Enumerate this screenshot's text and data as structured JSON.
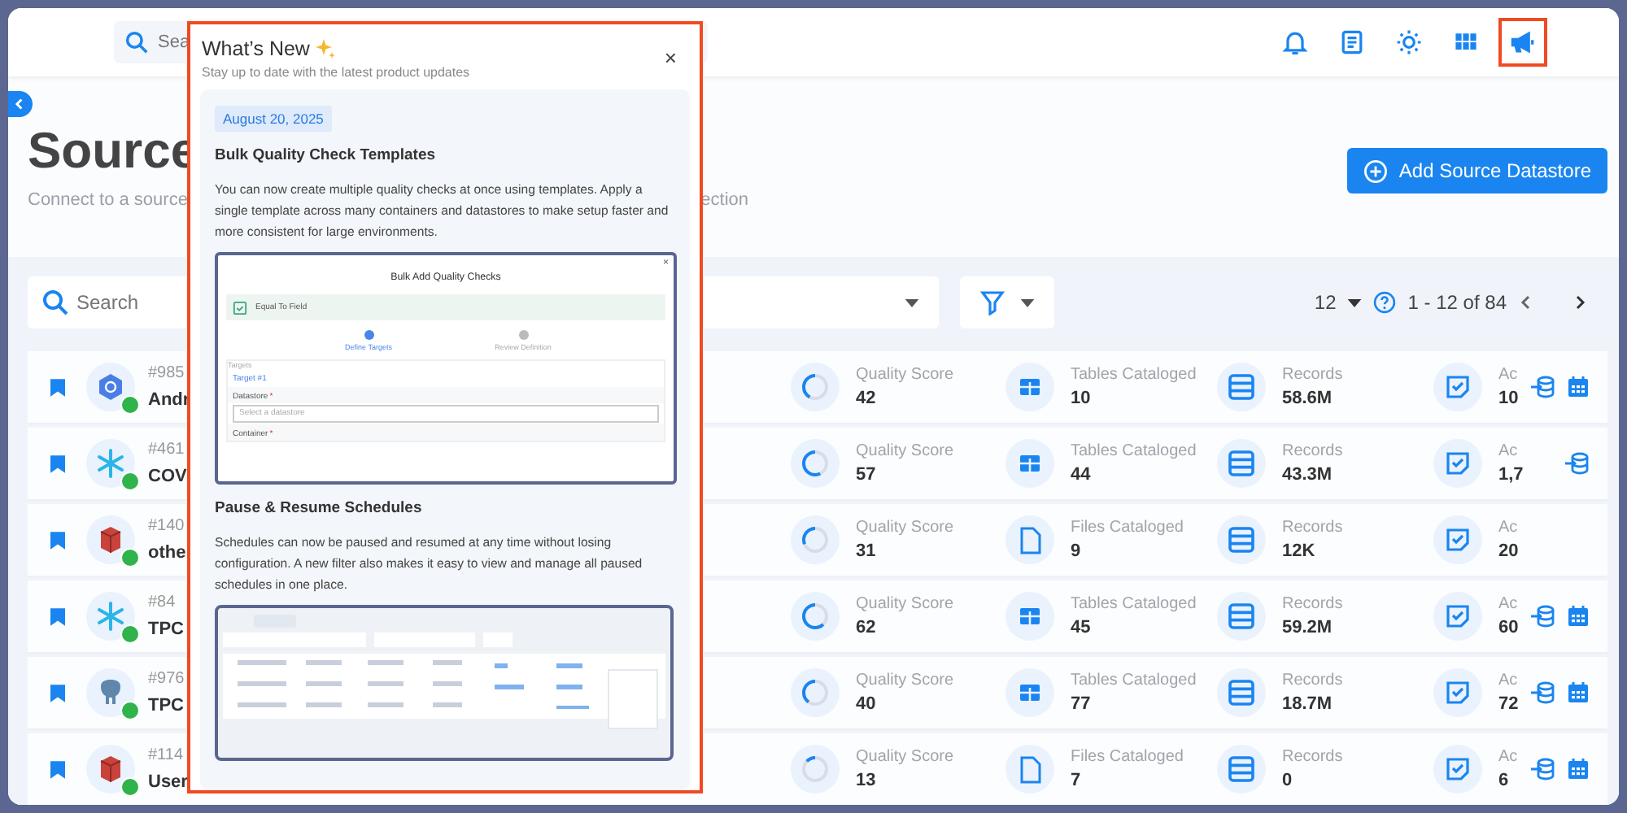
{
  "header": {
    "search_placeholder": "Sea",
    "icons": [
      {
        "kind": "bell",
        "selected": false
      },
      {
        "kind": "document",
        "selected": false
      },
      {
        "kind": "sun",
        "selected": false
      },
      {
        "kind": "grid",
        "selected": false
      },
      {
        "kind": "megaphone",
        "selected": true
      }
    ]
  },
  "page": {
    "title": "Source",
    "subtitle_left": "Connect to a source",
    "subtitle_right": "ection",
    "add_button": "Add Source Datastore"
  },
  "toolbar": {
    "search_placeholder": "Search",
    "page_size": "12",
    "range": "1 - 12 of 84"
  },
  "rows": [
    {
      "id": "#985",
      "name": "Andr",
      "logo": {
        "kind": "bigquery"
      },
      "metrics": [
        {
          "kind": "quality",
          "label": "Quality Score",
          "value": "42",
          "level": 0.42
        },
        {
          "kind": "tables",
          "label": "Tables Cataloged",
          "value": "10"
        },
        {
          "kind": "records",
          "label": "Records",
          "value": "58.6M"
        },
        {
          "kind": "checks",
          "label": "Ac",
          "value": "10"
        }
      ],
      "actions": [
        {
          "kind": "sync"
        },
        {
          "kind": "schedule"
        }
      ]
    },
    {
      "id": "#461",
      "name": "COV",
      "logo": {
        "kind": "snowflake"
      },
      "metrics": [
        {
          "kind": "quality",
          "label": "Quality Score",
          "value": "57",
          "level": 0.57
        },
        {
          "kind": "tables",
          "label": "Tables Cataloged",
          "value": "44"
        },
        {
          "kind": "records",
          "label": "Records",
          "value": "43.3M"
        },
        {
          "kind": "checks",
          "label": "Ac",
          "value": "1,7"
        }
      ],
      "actions": [
        {
          "kind": "sync"
        }
      ]
    },
    {
      "id": "#140",
      "name": "othe",
      "logo": {
        "kind": "redshift"
      },
      "metrics": [
        {
          "kind": "quality",
          "label": "Quality Score",
          "value": "31",
          "level": 0.31
        },
        {
          "kind": "files",
          "label": "Files Cataloged",
          "value": "9"
        },
        {
          "kind": "records",
          "label": "Records",
          "value": "12K"
        },
        {
          "kind": "checks",
          "label": "Ac",
          "value": "20"
        }
      ]
    },
    {
      "id": "#84",
      "name": "TPC",
      "logo": {
        "kind": "snowflake"
      },
      "metrics": [
        {
          "kind": "quality",
          "label": "Quality Score",
          "value": "62",
          "level": 0.62
        },
        {
          "kind": "tables",
          "label": "Tables Cataloged",
          "value": "45"
        },
        {
          "kind": "records",
          "label": "Records",
          "value": "59.2M"
        },
        {
          "kind": "checks",
          "label": "Ac",
          "value": "60"
        }
      ],
      "actions": [
        {
          "kind": "sync"
        },
        {
          "kind": "schedule"
        }
      ]
    },
    {
      "id": "#976",
      "name": "TPC",
      "logo": {
        "kind": "postgres"
      },
      "metrics": [
        {
          "kind": "quality",
          "label": "Quality Score",
          "value": "40",
          "level": 0.4
        },
        {
          "kind": "tables",
          "label": "Tables Cataloged",
          "value": "77"
        },
        {
          "kind": "records",
          "label": "Records",
          "value": "18.7M"
        },
        {
          "kind": "checks",
          "label": "Ac",
          "value": "72"
        }
      ],
      "actions": [
        {
          "kind": "sync"
        },
        {
          "kind": "schedule"
        }
      ]
    },
    {
      "id": "#114",
      "name": "User",
      "logo": {
        "kind": "redshift"
      },
      "metrics": [
        {
          "kind": "quality",
          "label": "Quality Score",
          "value": "13",
          "level": 0.13
        },
        {
          "kind": "files",
          "label": "Files Cataloged",
          "value": "7"
        },
        {
          "kind": "records",
          "label": "Records",
          "value": "0"
        },
        {
          "kind": "checks",
          "label": "Ac",
          "value": "6"
        }
      ],
      "actions": [
        {
          "kind": "sync"
        },
        {
          "kind": "schedule"
        }
      ]
    }
  ],
  "whats_new": {
    "title": "What’s New",
    "subtitle": "Stay up to date with the latest product updates",
    "close": "×",
    "date": "August 20, 2025",
    "updates": [
      {
        "title": "Bulk Quality Check Templates",
        "body": "You can now create multiple quality checks at once using templates. Apply a single template across many containers and datastores to make setup faster and more consistent for large environments.",
        "preview": {
          "kind": "bulk_checks",
          "title": "Bulk Add Quality Checks",
          "close": "×",
          "check_name": "Equal To Field",
          "steps": [
            {
              "label": "Define Targets",
              "selected": true
            },
            {
              "label": "Review Definition",
              "selected": false
            }
          ],
          "section": "Targets",
          "target": "Target #1",
          "fields": [
            {
              "label": "Datastore",
              "required_mark": "*",
              "placeholder": "Select a datastore"
            },
            {
              "label": "Container",
              "required_mark": "*"
            }
          ]
        }
      },
      {
        "title": "Pause & Resume Schedules",
        "body": "Schedules can now be paused and resumed at any time without losing configuration. A new filter also makes it easy to view and manage all paused schedules in one place.",
        "preview": {
          "kind": "schedules"
        }
      }
    ]
  }
}
